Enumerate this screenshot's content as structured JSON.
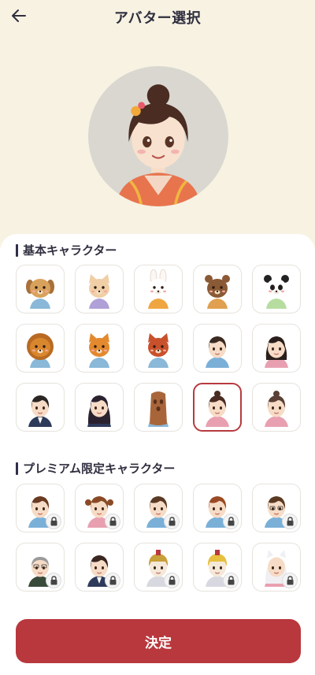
{
  "header": {
    "title": "アバター選択"
  },
  "sections": {
    "basic": {
      "title": "基本キャラクター",
      "items": [
        {
          "kind": "dog",
          "color": "#d9a25c"
        },
        {
          "kind": "cat",
          "color": "#f0cfa7"
        },
        {
          "kind": "rabbit",
          "color": "#fbf7f2"
        },
        {
          "kind": "bear",
          "color": "#8a5a36"
        },
        {
          "kind": "panda",
          "color": "#ffffff"
        },
        {
          "kind": "lion",
          "color": "#d9872e"
        },
        {
          "kind": "tiger",
          "color": "#e3892e"
        },
        {
          "kind": "red-panda",
          "color": "#c8512b"
        },
        {
          "kind": "boy",
          "color": "#3a2a22"
        },
        {
          "kind": "girl",
          "color": "#2a1f1c"
        },
        {
          "kind": "man-suit",
          "color": "#2b2624"
        },
        {
          "kind": "woman-long-hair",
          "color": "#2b2230"
        },
        {
          "kind": "haniwa",
          "color": "#a9653a"
        },
        {
          "kind": "kimono-girl",
          "color": "#4a2c22"
        },
        {
          "kind": "elder-woman",
          "color": "#5a4036"
        }
      ],
      "selected_index": 13
    },
    "premium": {
      "title": "プレミアム限定キャラクター",
      "items": [
        {
          "kind": "boy-premium",
          "color": "#6a3a22"
        },
        {
          "kind": "girl-twintails",
          "color": "#8a4a26"
        },
        {
          "kind": "young-man",
          "color": "#5a3a24"
        },
        {
          "kind": "boy-bandage",
          "color": "#9a4a24"
        },
        {
          "kind": "man-glasses",
          "color": "#5a3a22"
        },
        {
          "kind": "old-man",
          "color": "#9a9a9a"
        },
        {
          "kind": "woman-bob",
          "color": "#3a2620"
        },
        {
          "kind": "robot-gold",
          "color": "#c8a03a"
        },
        {
          "kind": "robot-girl",
          "color": "#e8c040"
        },
        {
          "kind": "fox-girl",
          "color": "#eeeeee"
        }
      ],
      "locked": true
    }
  },
  "confirm_label": "決定",
  "colors": {
    "background": "#f7f2e2",
    "accent": "#b8383d",
    "selected_border": "#b63a3f"
  },
  "icons": {
    "back": "arrow-left-icon",
    "lock": "lock-icon"
  }
}
